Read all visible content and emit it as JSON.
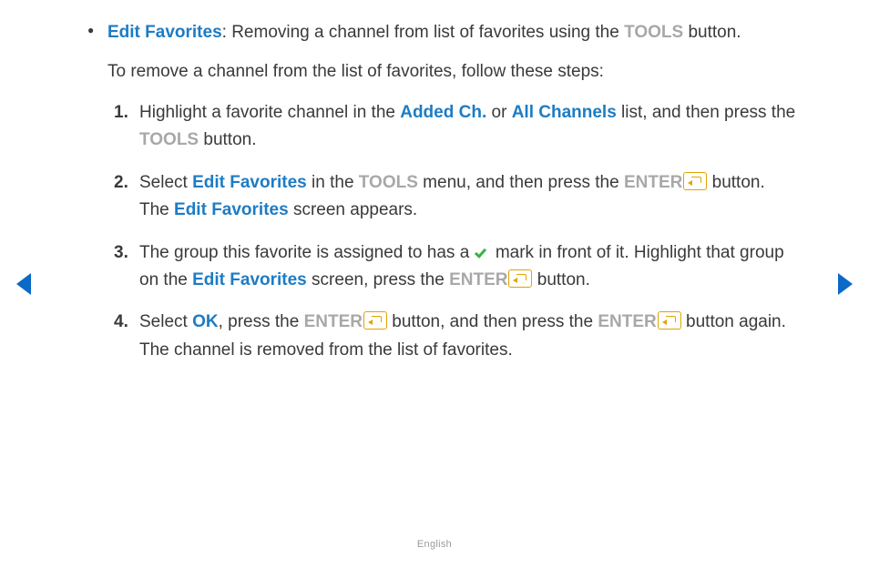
{
  "intro": {
    "edit_fav": "Edit Favorites",
    "intro_after": ": Removing a channel from list of favorites using the ",
    "tools": "TOOLS",
    "intro_tail": " button.",
    "secondary": "To remove a channel from the list of favorites, follow these steps:"
  },
  "step1": {
    "a": "Highlight a favorite channel in the ",
    "added_ch": "Added Ch.",
    "or": " or ",
    "all_ch": "All Channels",
    "b": " list, and then press the ",
    "tools": "TOOLS",
    "c": " button."
  },
  "step2": {
    "a": "Select ",
    "edit_fav": "Edit Favorites",
    "b": " in the ",
    "tools": "TOOLS",
    "c": " menu, and then press the ",
    "enter": "ENTER",
    "d": " button. The ",
    "edit_fav2": "Edit Favorites",
    "e": " screen appears."
  },
  "step3": {
    "a": "The group this favorite is assigned to has a ",
    "b": " mark in front of it. Highlight that group on the ",
    "edit_fav": "Edit Favorites",
    "c": " screen, press the ",
    "enter": "ENTER",
    "d": " button."
  },
  "step4": {
    "a": "Select ",
    "ok": "OK",
    "b": ", press the ",
    "enter": "ENTER",
    "c": " button, and then press the ",
    "enter2": "ENTER",
    "d": " button again. The channel is removed from the list of favorites."
  },
  "footer": {
    "lang": "English"
  }
}
